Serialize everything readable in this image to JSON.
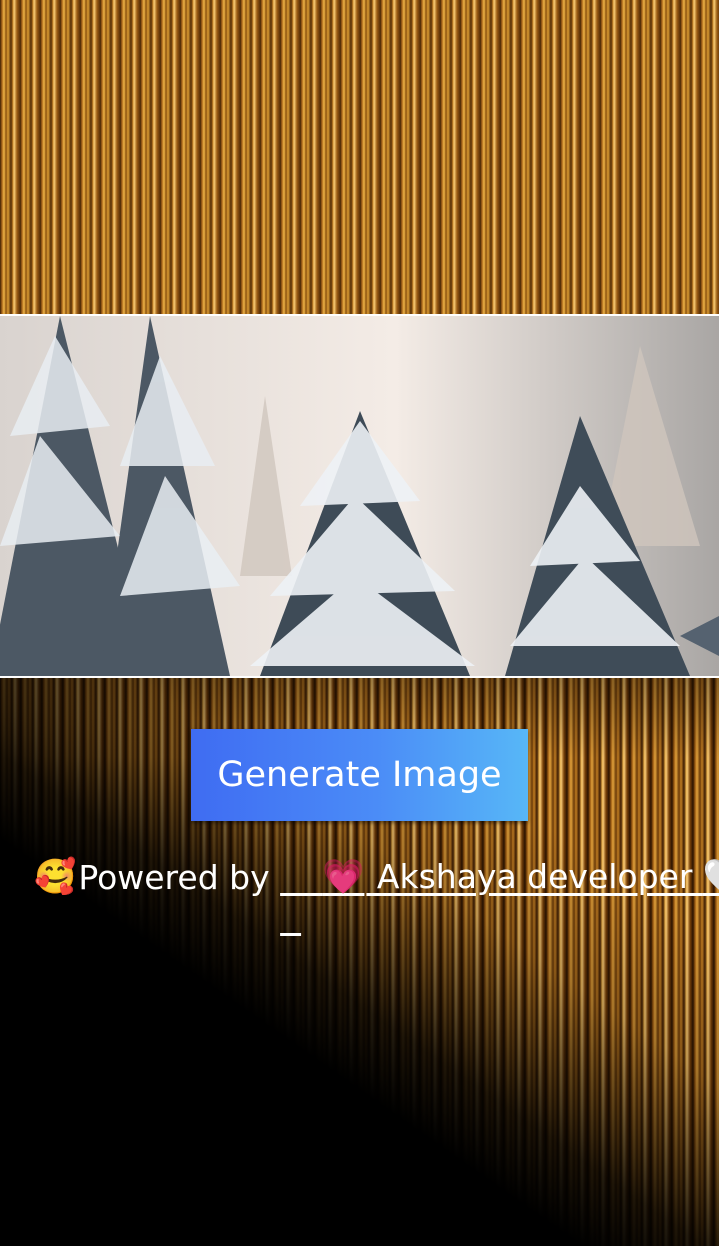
{
  "button": {
    "label": "Generate Image"
  },
  "credit": {
    "prefix_emoji": "🥰",
    "prefix_text": "Powered by ",
    "link_emoji_left": "💗",
    "link_text": " Akshaya developer ",
    "link_emoji_right": "🤍"
  },
  "colors": {
    "button_gradient_start": "#3f6cf2",
    "button_gradient_end": "#57b7f7",
    "text": "#ffffff"
  }
}
